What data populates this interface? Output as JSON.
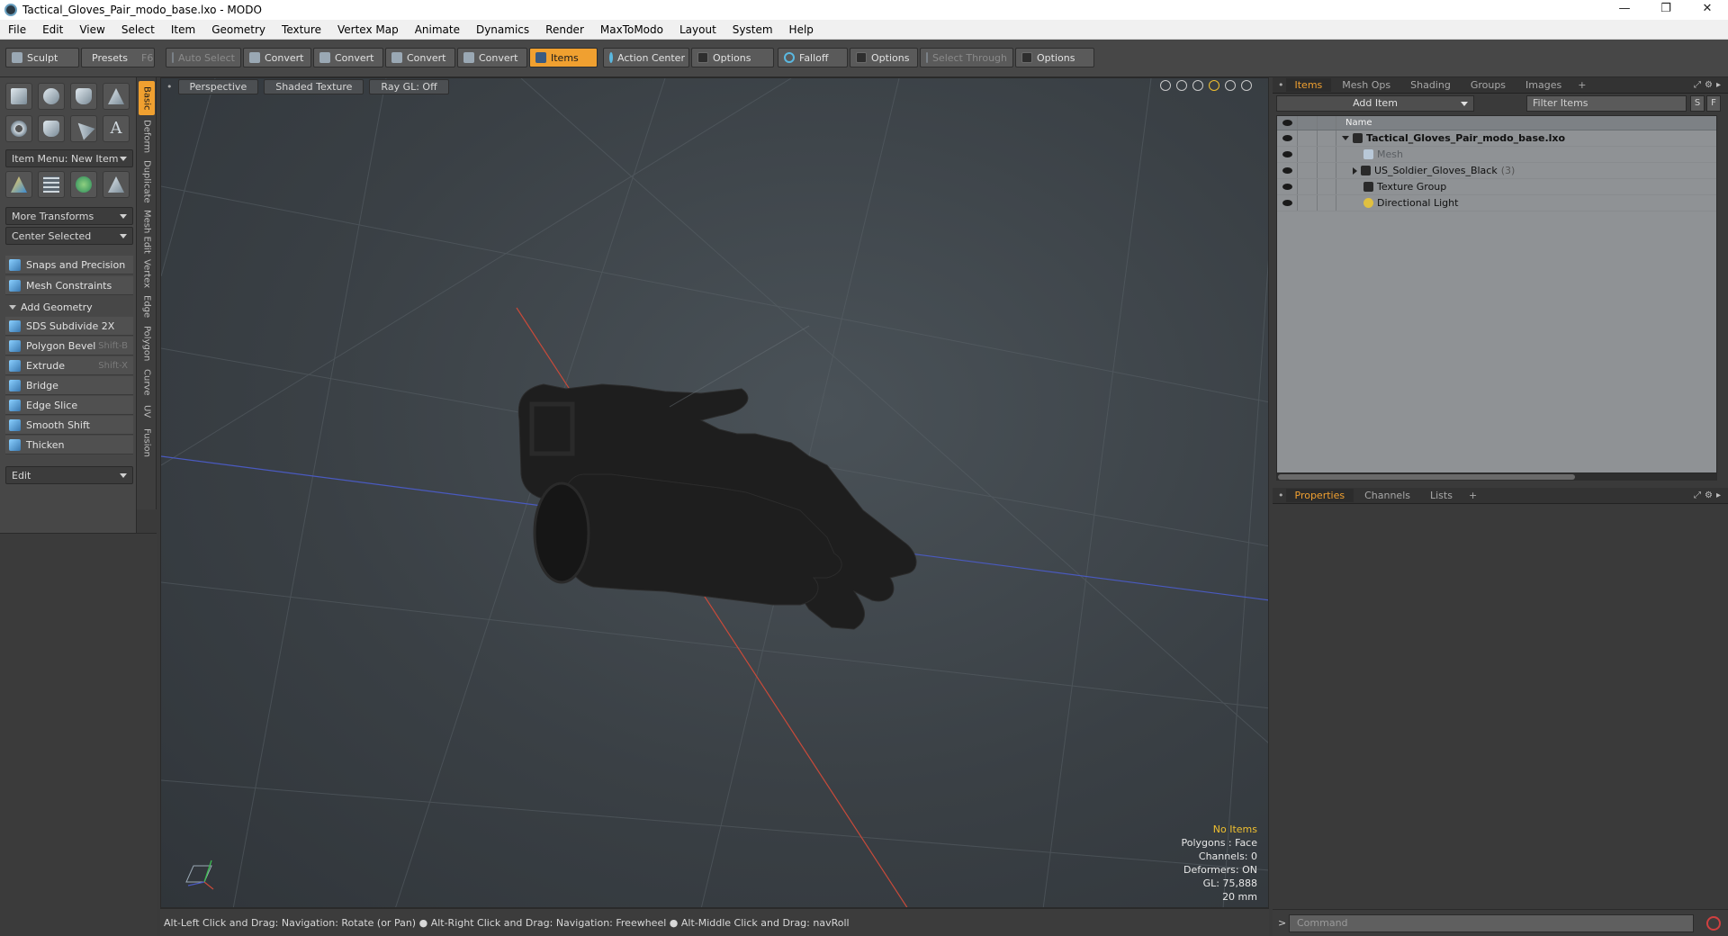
{
  "window": {
    "title": "Tactical_Gloves_Pair_modo_base.lxo - MODO",
    "controls": [
      "—",
      "❐",
      "✕"
    ]
  },
  "menu": [
    "File",
    "Edit",
    "View",
    "Select",
    "Item",
    "Geometry",
    "Texture",
    "Vertex Map",
    "Animate",
    "Dynamics",
    "Render",
    "MaxToModo",
    "Layout",
    "System",
    "Help"
  ],
  "toolbar": {
    "sculpt": "Sculpt",
    "presets": "Presets",
    "presets_shortcut": "F6",
    "auto_select": "Auto Select",
    "convert1": "Convert",
    "convert2": "Convert",
    "convert3": "Convert",
    "convert4": "Convert",
    "items": "Items",
    "action_center": "Action Center",
    "options1": "Options",
    "falloff": "Falloff",
    "options2": "Options",
    "select_through": "Select Through",
    "options3": "Options"
  },
  "left_panel": {
    "item_menu": "Item Menu: New Item",
    "more_transforms": "More Transforms",
    "center_selected": "Center Selected",
    "snaps": "Snaps and Precision",
    "mesh_constraints": "Mesh Constraints",
    "add_geometry": "Add Geometry",
    "tools": [
      {
        "label": "SDS Subdivide 2X",
        "shortcut": ""
      },
      {
        "label": "Polygon Bevel",
        "shortcut": "Shift-B"
      },
      {
        "label": "Extrude",
        "shortcut": "Shift-X"
      },
      {
        "label": "Bridge",
        "shortcut": ""
      },
      {
        "label": "Edge Slice",
        "shortcut": ""
      },
      {
        "label": "Smooth Shift",
        "shortcut": ""
      },
      {
        "label": "Thicken",
        "shortcut": ""
      }
    ],
    "edit": "Edit"
  },
  "vertical_tabs": [
    "Basic",
    "Deform",
    "Duplicate",
    "Mesh Edit",
    "Vertex",
    "Edge",
    "Polygon",
    "Curve",
    "UV",
    "Fusion"
  ],
  "viewport": {
    "view": "Perspective",
    "shading": "Shaded Texture",
    "raygl": "Ray GL: Off",
    "stats": {
      "selection": "No Items",
      "polygons": "Polygons : Face",
      "channels": "Channels: 0",
      "deformers": "Deformers: ON",
      "gl": "GL: 75,888",
      "scale": "20 mm"
    }
  },
  "status_bar": "Alt-Left Click and Drag: Navigation: Rotate (or Pan) ● Alt-Right Click and Drag: Navigation: Freewheel ● Alt-Middle Click and Drag: navRoll",
  "items_panel": {
    "tabs": [
      "Items",
      "Mesh Ops",
      "Shading",
      "Groups",
      "Images"
    ],
    "add_item": "Add Item",
    "filter_placeholder": "Filter Items",
    "s_btn": "S",
    "f_btn": "F",
    "name_header": "Name",
    "tree": [
      {
        "label": "Tactical_Gloves_Pair_modo_base.lxo",
        "count": ""
      },
      {
        "label": "Mesh",
        "count": ""
      },
      {
        "label": "US_Soldier_Gloves_Black",
        "count": "(3)"
      },
      {
        "label": "Texture Group",
        "count": ""
      },
      {
        "label": "Directional Light",
        "count": ""
      }
    ]
  },
  "properties_panel": {
    "tabs": [
      "Properties",
      "Channels",
      "Lists"
    ]
  },
  "command": {
    "prompt": ">",
    "placeholder": "Command"
  },
  "colors": {
    "accent": "#f0a030",
    "x_axis": "#c84a3a",
    "z_axis": "#4a5ac0"
  }
}
